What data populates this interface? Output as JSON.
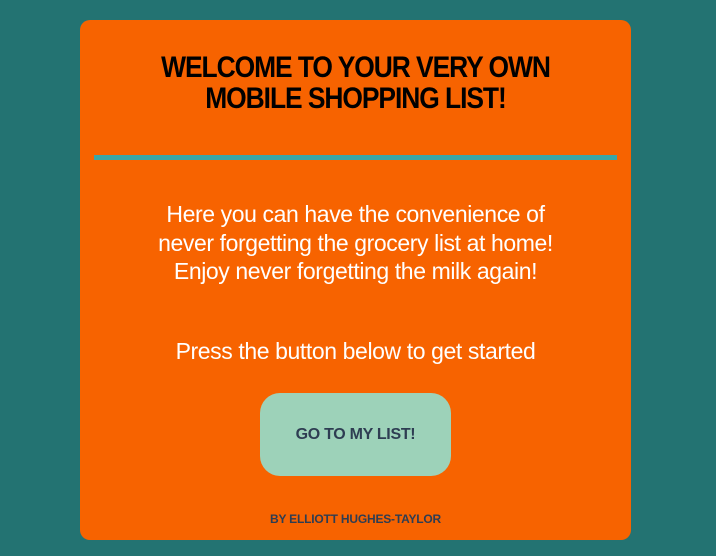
{
  "colors": {
    "background": "#237372",
    "card": "#f76300",
    "divider": "#3aa6a6",
    "button": "#9dd2b9",
    "button_text": "#2e3d52"
  },
  "header": {
    "title_line1": "WELCOME TO YOUR VERY OWN",
    "title_line2": "MOBILE SHOPPING LIST!"
  },
  "main": {
    "intro": "Here you can have the convenience of never forgetting the grocery list at home! Enjoy never forgetting the milk again!",
    "cta": "Press the button below to get started",
    "button_label": "GO TO MY LIST!"
  },
  "footer": {
    "credit": "BY ELLIOTT HUGHES-TAYLOR"
  }
}
